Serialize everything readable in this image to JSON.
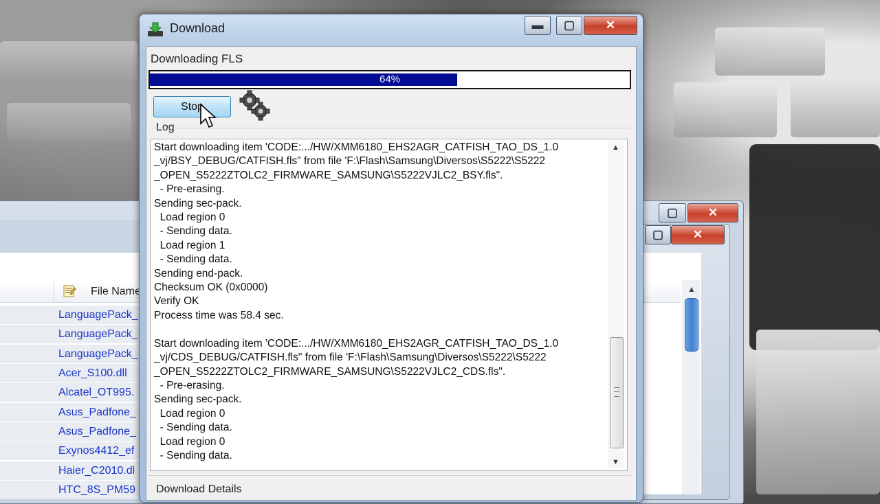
{
  "window": {
    "title": "Download",
    "status_label": "Downloading FLS",
    "progress": {
      "value": 0.64,
      "text": "64%"
    },
    "stop_label": "Stop",
    "log_label": "Log",
    "details_label": "Download Details"
  },
  "log_lines": [
    "Start downloading item 'CODE:.../HW/XMM6180_EHS2AGR_CATFISH_TAO_DS_1.0",
    "_vj/BSY_DEBUG/CATFISH.fls\" from file 'F:\\Flash\\Samsung\\Diversos\\S5222\\S5222",
    "_OPEN_S5222ZTOLC2_FIRMWARE_SAMSUNG\\S5222VJLC2_BSY.fls\".",
    "  - Pre-erasing.",
    "Sending sec-pack.",
    "  Load region 0",
    "  - Sending data.",
    "  Load region 1",
    "  - Sending data.",
    "Sending end-pack.",
    "Checksum OK (0x0000)",
    "Verify OK",
    "Process time was 58.4 sec.",
    "",
    "Start downloading item 'CODE:.../HW/XMM6180_EHS2AGR_CATFISH_TAO_DS_1.0",
    "_vj/CDS_DEBUG/CATFISH.fls\" from file 'F:\\Flash\\Samsung\\Diversos\\S5222\\S5222",
    "_OPEN_S5222ZTOLC2_FIRMWARE_SAMSUNG\\S5222VJLC2_CDS.fls\".",
    "  - Pre-erasing.",
    "Sending sec-pack.",
    "  Load region 0",
    "  - Sending data.",
    "  Load region 0",
    "  - Sending data."
  ],
  "back_window": {
    "column_header": "File Name",
    "files": [
      "LanguagePack_",
      "LanguagePack_",
      "LanguagePack_",
      "Acer_S100.dll",
      "Alcatel_OT995.",
      "Asus_Padfone_",
      "Asus_Padfone_",
      "Exynos4412_ef",
      "Haier_C2010.dl",
      "HTC_8S_PM59"
    ]
  },
  "colors": {
    "progress_fill": "#020c94",
    "link_text": "#1a35c9",
    "close_button": "#c7402a"
  }
}
